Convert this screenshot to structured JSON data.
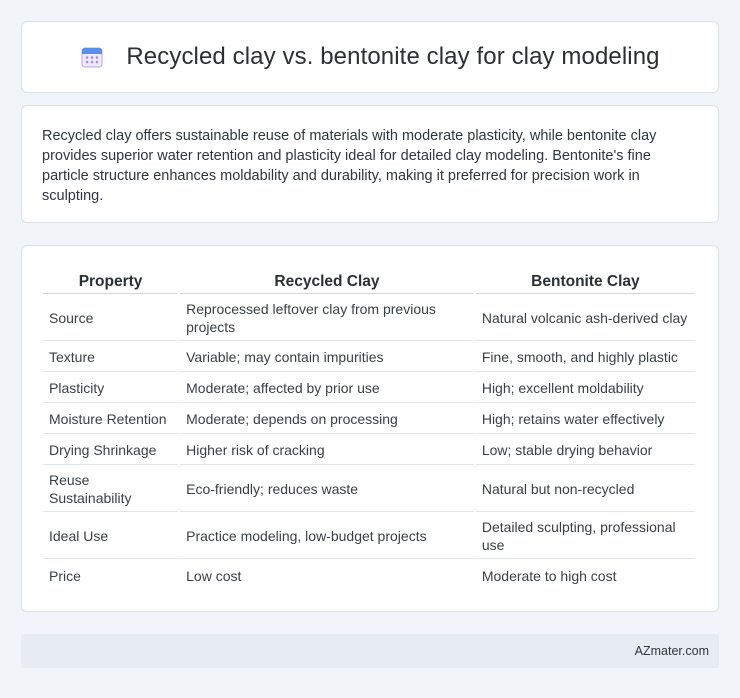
{
  "header": {
    "title": "Recycled clay vs. bentonite clay for clay modeling",
    "icon": "calendar-icon"
  },
  "summary": {
    "text": "Recycled clay offers sustainable reuse of materials with moderate plasticity, while bentonite clay provides superior water retention and plasticity ideal for detailed clay modeling. Bentonite's fine particle structure enhances moldability and durability, making it preferred for precision work in sculpting."
  },
  "table": {
    "headers": [
      "Property",
      "Recycled Clay",
      "Bentonite Clay"
    ],
    "rows": [
      [
        "Source",
        "Reprocessed leftover clay from previous projects",
        "Natural volcanic ash-derived clay"
      ],
      [
        "Texture",
        "Variable; may contain impurities",
        "Fine, smooth, and highly plastic"
      ],
      [
        "Plasticity",
        "Moderate; affected by prior use",
        "High; excellent moldability"
      ],
      [
        "Moisture Retention",
        "Moderate; depends on processing",
        "High; retains water effectively"
      ],
      [
        "Drying Shrinkage",
        "Higher risk of cracking",
        "Low; stable drying behavior"
      ],
      [
        "Reuse Sustainability",
        "Eco-friendly; reduces waste",
        "Natural but non-recycled"
      ],
      [
        "Ideal Use",
        "Practice modeling, low-budget projects",
        "Detailed sculpting, professional use"
      ],
      [
        "Price",
        "Low cost",
        "Moderate to high cost"
      ]
    ]
  },
  "footer": {
    "site": "AZmater.com"
  },
  "colors": {
    "background": "#f1f4f9",
    "card": "#ffffff",
    "footer_bg": "#e6ebf4",
    "icon_blue": "#5b8def",
    "icon_purple": "#a48be0"
  }
}
